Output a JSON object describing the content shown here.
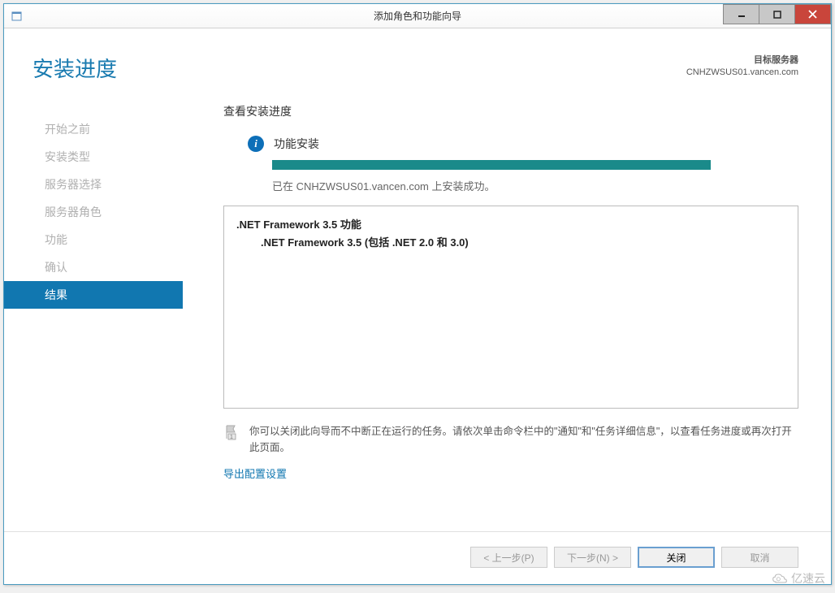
{
  "window": {
    "title": "添加角色和功能向导"
  },
  "header": {
    "page_title": "安装进度",
    "target_label": "目标服务器",
    "target_server": "CNHZWSUS01.vancen.com"
  },
  "sidebar": {
    "items": [
      {
        "label": "开始之前",
        "active": false
      },
      {
        "label": "安装类型",
        "active": false
      },
      {
        "label": "服务器选择",
        "active": false
      },
      {
        "label": "服务器角色",
        "active": false
      },
      {
        "label": "功能",
        "active": false
      },
      {
        "label": "确认",
        "active": false
      },
      {
        "label": "结果",
        "active": true
      }
    ]
  },
  "main": {
    "subtitle": "查看安装进度",
    "status": "功能安装",
    "success_message": "已在 CNHZWSUS01.vancen.com 上安装成功。",
    "feature_parent": ".NET Framework 3.5 功能",
    "feature_child": ".NET Framework 3.5 (包括 .NET 2.0 和 3.0)",
    "notice": "你可以关闭此向导而不中断正在运行的任务。请依次单击命令栏中的\"通知\"和\"任务详细信息\"，以查看任务进度或再次打开此页面。",
    "export_link": "导出配置设置"
  },
  "buttons": {
    "previous": "< 上一步(P)",
    "next": "下一步(N) >",
    "close": "关闭",
    "cancel": "取消"
  },
  "watermark": "亿速云"
}
